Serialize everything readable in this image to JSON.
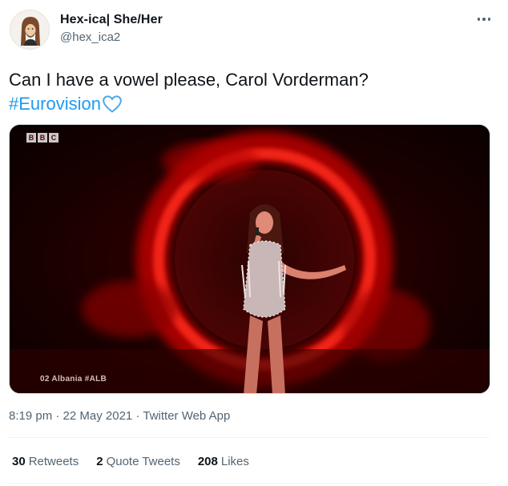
{
  "user": {
    "name": "Hex-ica| She/Her",
    "handle": "@hex_ica2"
  },
  "tweet": {
    "text": "Can I have a vowel please, Carol Vorderman?",
    "hashtag": "#Eurovision",
    "emoji": "light-blue-heart-icon"
  },
  "media": {
    "broadcaster": [
      "B",
      "B",
      "C"
    ],
    "caption": "02 Albania #ALB"
  },
  "meta": {
    "time": "8:19 pm",
    "separator": "·",
    "date": "22 May 2021",
    "source": "Twitter Web App"
  },
  "stats": {
    "retweets_count": "30",
    "retweets_label": "Retweets",
    "quotes_count": "2",
    "quotes_label": "Quote Tweets",
    "likes_count": "208",
    "likes_label": "Likes"
  },
  "colors": {
    "link": "#1d9bf0",
    "secondary_text": "#536471",
    "primary_text": "#0f1419"
  }
}
